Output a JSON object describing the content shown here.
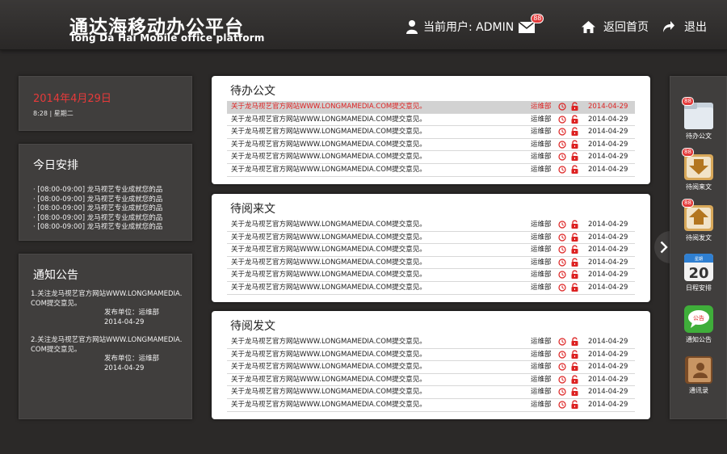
{
  "header": {
    "logo_cn": "通达海移动办公平台",
    "logo_en": "Tong Da Hai Mobile office platform",
    "current_user": "当前用户: ADMIN",
    "mail_badge": "88",
    "home_label": "返回首页",
    "exit_label": "退出"
  },
  "date_panel": {
    "date": "2014年4月29日",
    "time_weekday": "8:28 | 星期二"
  },
  "today_panel": {
    "title": "今日安排",
    "items": [
      "· [08:00-09:00] 龙马视艺专业成就您的品",
      "· [08:00-09:00] 龙马视艺专业成就您的品",
      "· [08:00-09:00] 龙马视艺专业成就您的品",
      "· [08:00-09:00] 龙马视艺专业成就您的品",
      "· [08:00-09:00] 龙马视艺专业成就您的品"
    ]
  },
  "notice_panel": {
    "title": "通知公告",
    "items": [
      {
        "text": "1.关注龙马视艺官方网站WWW.LONGMAMEDIA.COM提交意见。",
        "publisher": "发布单位：运维部",
        "date": "2014-04-29"
      },
      {
        "text": "2.关注龙马视艺官方网站WWW.LONGMAMEDIA.COM提交意见。",
        "publisher": "发布单位：运维部",
        "date": "2014-04-29"
      }
    ]
  },
  "doc_panels": [
    {
      "title": "待办公文",
      "rows": [
        {
          "title": "关于龙马视艺官方网站WWW.LONGMAMEDIA.COM提交意见。",
          "dept": "运维部",
          "date": "2014-04-29"
        },
        {
          "title": "关于龙马视艺官方网站WWW.LONGMAMEDIA.COM提交意见。",
          "dept": "运维部",
          "date": "2014-04-29"
        },
        {
          "title": "关于龙马视艺官方网站WWW.LONGMAMEDIA.COM提交意见。",
          "dept": "运维部",
          "date": "2014-04-29"
        },
        {
          "title": "关于龙马视艺官方网站WWW.LONGMAMEDIA.COM提交意见。",
          "dept": "运维部",
          "date": "2014-04-29"
        },
        {
          "title": "关于龙马视艺官方网站WWW.LONGMAMEDIA.COM提交意见。",
          "dept": "运维部",
          "date": "2014-04-29"
        },
        {
          "title": "关于龙马视艺官方网站WWW.LONGMAMEDIA.COM提交意见。",
          "dept": "运维部",
          "date": "2014-04-29"
        }
      ]
    },
    {
      "title": "待阅来文",
      "rows": [
        {
          "title": "关于龙马视艺官方网站WWW.LONGMAMEDIA.COM提交意见。",
          "dept": "运维部",
          "date": "2014-04-29"
        },
        {
          "title": "关于龙马视艺官方网站WWW.LONGMAMEDIA.COM提交意见。",
          "dept": "运维部",
          "date": "2014-04-29"
        },
        {
          "title": "关于龙马视艺官方网站WWW.LONGMAMEDIA.COM提交意见。",
          "dept": "运维部",
          "date": "2014-04-29"
        },
        {
          "title": "关于龙马视艺官方网站WWW.LONGMAMEDIA.COM提交意见。",
          "dept": "运维部",
          "date": "2014-04-29"
        },
        {
          "title": "关于龙马视艺官方网站WWW.LONGMAMEDIA.COM提交意见。",
          "dept": "运维部",
          "date": "2014-04-29"
        },
        {
          "title": "关于龙马视艺官方网站WWW.LONGMAMEDIA.COM提交意见。",
          "dept": "运维部",
          "date": "2014-04-29"
        }
      ]
    },
    {
      "title": "待阅发文",
      "rows": [
        {
          "title": "关于龙马视艺官方网站WWW.LONGMAMEDIA.COM提交意见。",
          "dept": "运维部",
          "date": "2014-04-29"
        },
        {
          "title": "关于龙马视艺官方网站WWW.LONGMAMEDIA.COM提交意见。",
          "dept": "运维部",
          "date": "2014-04-29"
        },
        {
          "title": "关于龙马视艺官方网站WWW.LONGMAMEDIA.COM提交意见。",
          "dept": "运维部",
          "date": "2014-04-29"
        },
        {
          "title": "关于龙马视艺官方网站WWW.LONGMAMEDIA.COM提交意见。",
          "dept": "运维部",
          "date": "2014-04-29"
        },
        {
          "title": "关于龙马视艺官方网站WWW.LONGMAMEDIA.COM提交意见。",
          "dept": "运维部",
          "date": "2014-04-29"
        },
        {
          "title": "关于龙马视艺官方网站WWW.LONGMAMEDIA.COM提交意见。",
          "dept": "运维部",
          "date": "2014-04-29"
        }
      ]
    }
  ],
  "dock": {
    "items": [
      {
        "label": "待办公文",
        "badge": "88",
        "icon": "folder-icon"
      },
      {
        "label": "待阅来文",
        "badge": "88",
        "icon": "inbox-download-icon"
      },
      {
        "label": "待阅发文",
        "badge": "88",
        "icon": "outbox-upload-icon"
      },
      {
        "label": "日程安排",
        "icon": "calendar-icon",
        "calendar_top": "星期",
        "calendar_day": "20"
      },
      {
        "label": "通知公告",
        "icon": "chat-bubble-icon",
        "bubble_text": "公告"
      },
      {
        "label": "通讯录",
        "icon": "contacts-book-icon"
      }
    ]
  },
  "colors": {
    "accent_red": "#e73a3a",
    "background": "#2b2928",
    "panel": "#403e3d"
  }
}
